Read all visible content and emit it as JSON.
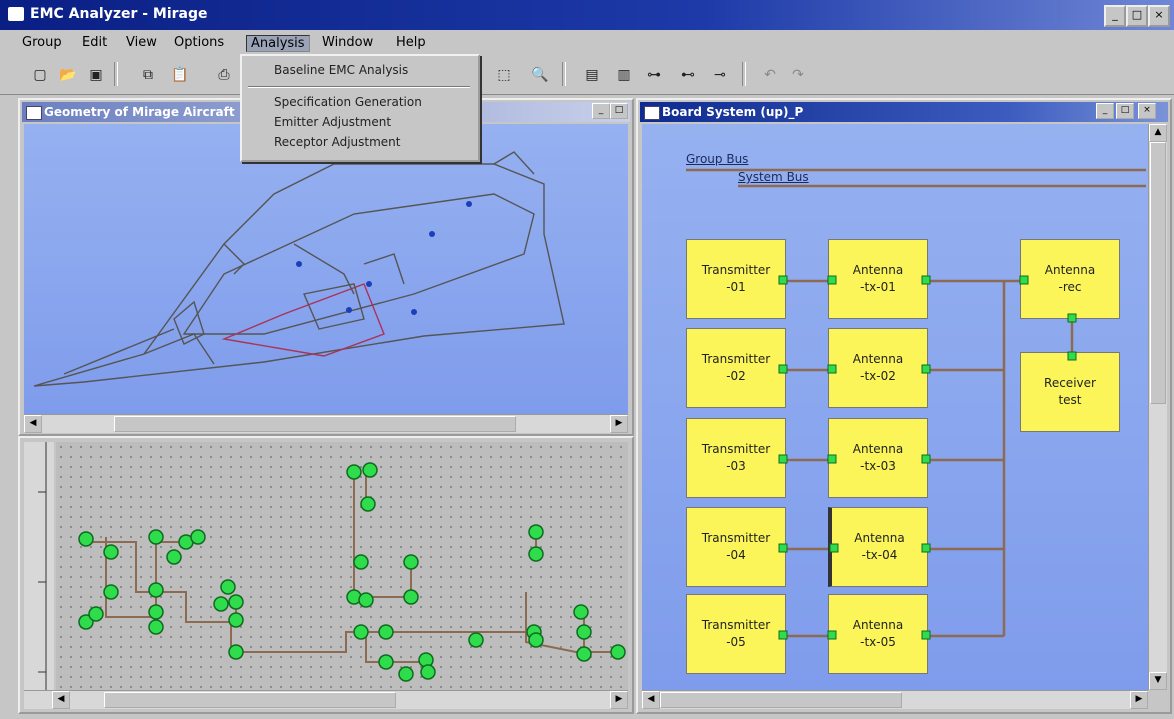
{
  "app": {
    "title": "EMC Analyzer - Mirage",
    "window_buttons": [
      "_",
      "□",
      "×"
    ]
  },
  "menubar": {
    "items": [
      {
        "label": "Group"
      },
      {
        "label": "Edit"
      },
      {
        "label": "View"
      },
      {
        "label": "Options"
      },
      {
        "label": "Analysis"
      },
      {
        "label": "Window"
      },
      {
        "label": "Help"
      }
    ]
  },
  "analysis_menu": {
    "items": [
      {
        "label": "Baseline EMC Analysis"
      },
      {
        "label": "Specification Generation"
      },
      {
        "label": "Emitter Adjustment"
      },
      {
        "label": "Receptor Adjustment"
      }
    ]
  },
  "toolbar": {
    "icons": [
      "new-file-icon",
      "open-icon",
      "save-icon",
      "copy-icon",
      "paste-icon",
      "print-icon",
      "select-icon",
      "zoom-icon",
      "add-block-icon",
      "add-group-icon",
      "connect-icon",
      "connect-icon",
      "connect-icon",
      "undo-icon",
      "redo-icon"
    ]
  },
  "geometry_window": {
    "title": "Geometry of Mirage Aircraft"
  },
  "board_window": {
    "title": "Board System (up)_P",
    "group_bus": "Group Bus",
    "system_bus": "System Bus",
    "transmitters": [
      {
        "label": "Transmitter\n-01"
      },
      {
        "label": "Transmitter\n-02"
      },
      {
        "label": "Transmitter\n-03"
      },
      {
        "label": "Transmitter\n-04"
      },
      {
        "label": "Transmitter\n-05"
      }
    ],
    "tx_antennas": [
      {
        "label": "Antenna\n-tx-01"
      },
      {
        "label": "Antenna\n-tx-02"
      },
      {
        "label": "Antenna\n-tx-03"
      },
      {
        "label": "Antenna\n-tx-04"
      },
      {
        "label": "Antenna\n-tx-05"
      }
    ],
    "rx_antenna": {
      "label": "Antenna\n-rec"
    },
    "receiver": {
      "label": "Receiver\ntest"
    }
  },
  "colors": {
    "canvas_blue": "#8aa6ee",
    "block_yellow": "#fbf55a",
    "node_green": "#2fdc4c"
  }
}
